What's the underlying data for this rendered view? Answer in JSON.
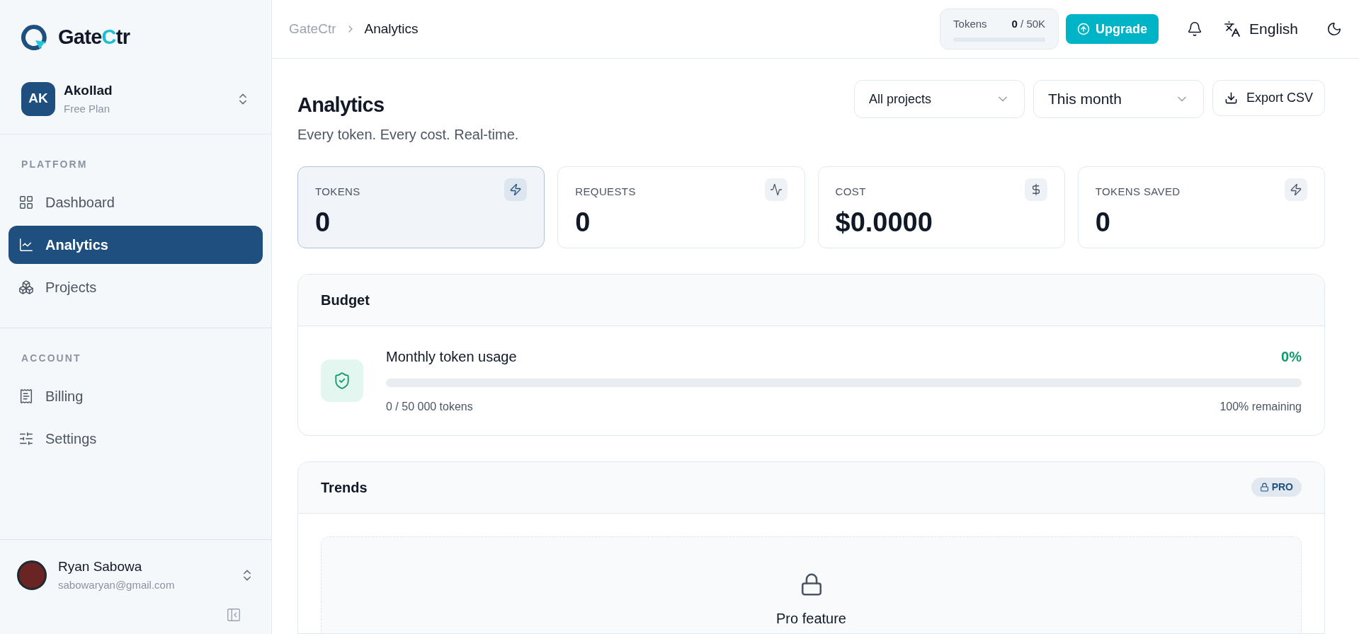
{
  "logo": {
    "before": "Gate",
    "accent": "C",
    "after": "tr"
  },
  "workspace": {
    "initials": "AK",
    "name": "Akollad",
    "plan": "Free Plan"
  },
  "sidebar": {
    "sections": [
      {
        "title": "PLATFORM",
        "items": [
          {
            "label": "Dashboard",
            "selected": false
          },
          {
            "label": "Analytics",
            "selected": true
          },
          {
            "label": "Projects",
            "selected": false
          }
        ]
      },
      {
        "title": "ACCOUNT",
        "items": [
          {
            "label": "Billing",
            "selected": false
          },
          {
            "label": "Settings",
            "selected": false
          }
        ]
      }
    ]
  },
  "user": {
    "name": "Ryan Sabowa",
    "email": "sabowaryan@gmail.com"
  },
  "breadcrumb": [
    "GateCtr",
    "Analytics"
  ],
  "token_meter": {
    "label": "Tokens",
    "used": "0",
    "limit": "/ 50K",
    "level": 0
  },
  "upgrade_button": "Upgrade",
  "language": "English",
  "page": {
    "title": "Analytics",
    "subtitle": "Every token. Every cost. Real-time."
  },
  "filters": [
    {
      "value": "All projects"
    },
    {
      "value": "This month"
    }
  ],
  "export_button": "Export CSV",
  "stats": [
    {
      "label": "TOKENS",
      "value": "0",
      "selected": true
    },
    {
      "label": "REQUESTS",
      "value": "0",
      "selected": false
    },
    {
      "label": "COST",
      "value": "$0.0000",
      "selected": false
    },
    {
      "label": "TOKENS SAVED",
      "value": "0",
      "selected": false
    }
  ],
  "budget": {
    "title": "Budget",
    "label": "Monthly token usage",
    "percent": "0%",
    "level": 0,
    "usage": "0 / 50 000 tokens",
    "remaining": "100% remaining"
  },
  "trends": {
    "title": "Trends",
    "badge": "PRO",
    "locked_title": "Pro feature"
  }
}
